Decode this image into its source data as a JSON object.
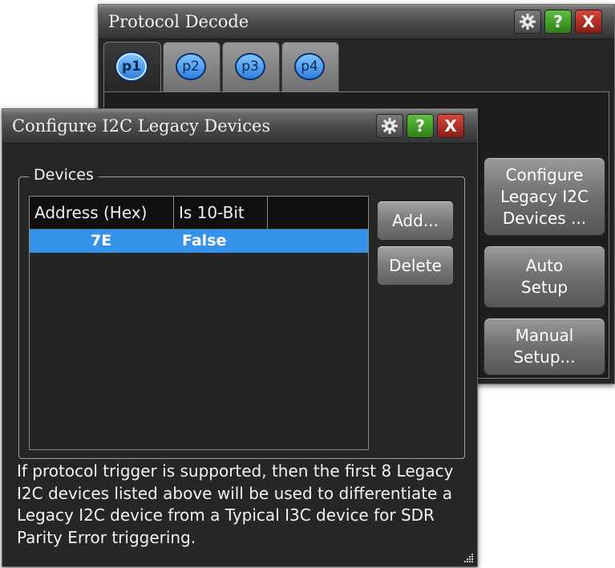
{
  "protocol_window": {
    "title": "Protocol Decode",
    "tabs": [
      {
        "label": "p1",
        "active": true
      },
      {
        "label": "p2",
        "active": false
      },
      {
        "label": "p3",
        "active": false
      },
      {
        "label": "p4",
        "active": false
      }
    ],
    "help_label": "?",
    "close_label": "X",
    "buttons": {
      "configure_legacy": "Configure Legacy I2C Devices ...",
      "auto_setup": "Auto Setup",
      "manual_setup": "Manual Setup..."
    }
  },
  "dialog": {
    "title": "Configure I2C Legacy Devices",
    "help_label": "?",
    "close_label": "X",
    "group_label": "Devices",
    "columns": [
      "Address (Hex)",
      "Is 10-Bit"
    ],
    "rows": [
      {
        "address": "7E",
        "is_10bit": "False",
        "selected": true
      }
    ],
    "add_label": "Add...",
    "delete_label": "Delete",
    "info_text": "If protocol trigger is supported, then the first 8 Legacy I2C devices listed above will be used to differentiate a Legacy I2C device from a Typical I3C device for SDR Parity Error triggering."
  },
  "icons": {
    "gear": "gear-icon",
    "help": "help-icon",
    "close": "close-icon",
    "resize": "resize-grip-icon"
  },
  "colors": {
    "selection": "#3592ea",
    "help_button": "#3fa028",
    "close_button": "#b8342a",
    "tab_circle": "#4a9cf2"
  }
}
